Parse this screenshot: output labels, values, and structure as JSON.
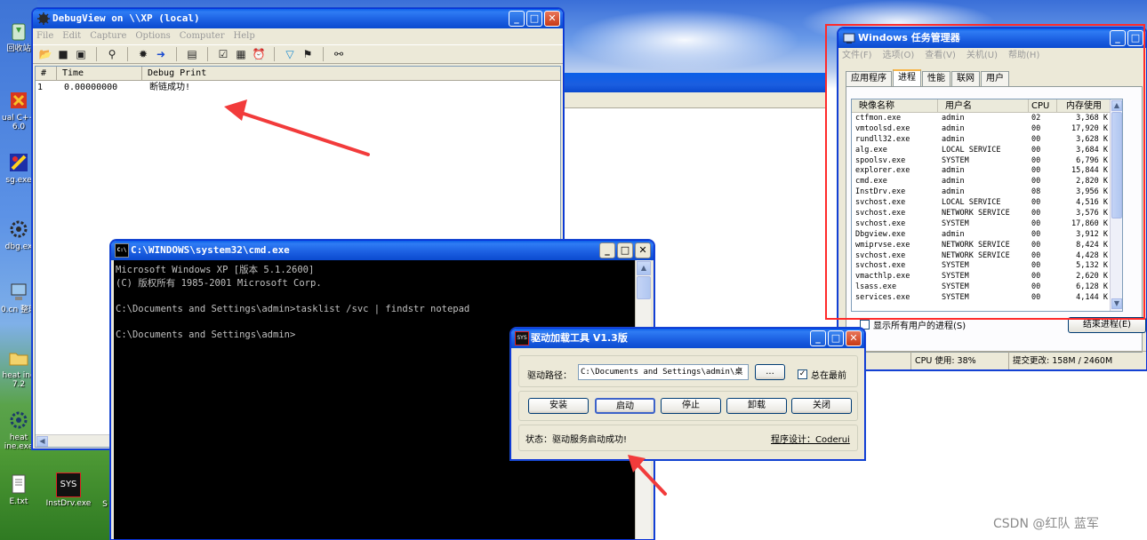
{
  "debugview": {
    "title": "DebugView on \\\\XP (local)",
    "menu": [
      "File",
      "Edit",
      "Capture",
      "Options",
      "Computer",
      "Help"
    ],
    "columns": [
      "#",
      "Time",
      "Debug Print"
    ],
    "rows": [
      {
        "num": "1",
        "time": "0.00000000",
        "msg": "断链成功!"
      }
    ]
  },
  "taskmgr": {
    "title": "Windows 任务管理器",
    "menu": [
      "文件(F)",
      "选项(O)",
      "查看(V)",
      "关机(U)",
      "帮助(H)"
    ],
    "tabs": [
      "应用程序",
      "进程",
      "性能",
      "联网",
      "用户"
    ],
    "active_tab": "进程",
    "columns": [
      "映像名称",
      "用户名",
      "CPU",
      "内存使用"
    ],
    "rows": [
      {
        "name": "ctfmon.exe",
        "user": "admin",
        "cpu": "02",
        "mem": "3,368 K"
      },
      {
        "name": "vmtoolsd.exe",
        "user": "admin",
        "cpu": "00",
        "mem": "17,920 K"
      },
      {
        "name": "rundll32.exe",
        "user": "admin",
        "cpu": "00",
        "mem": "3,628 K"
      },
      {
        "name": "alg.exe",
        "user": "LOCAL SERVICE",
        "cpu": "00",
        "mem": "3,684 K"
      },
      {
        "name": "spoolsv.exe",
        "user": "SYSTEM",
        "cpu": "00",
        "mem": "6,796 K"
      },
      {
        "name": "explorer.exe",
        "user": "admin",
        "cpu": "00",
        "mem": "15,844 K"
      },
      {
        "name": "cmd.exe",
        "user": "admin",
        "cpu": "00",
        "mem": "2,820 K"
      },
      {
        "name": "InstDrv.exe",
        "user": "admin",
        "cpu": "08",
        "mem": "3,956 K"
      },
      {
        "name": "svchost.exe",
        "user": "LOCAL SERVICE",
        "cpu": "00",
        "mem": "4,516 K"
      },
      {
        "name": "svchost.exe",
        "user": "NETWORK SERVICE",
        "cpu": "00",
        "mem": "3,576 K"
      },
      {
        "name": "svchost.exe",
        "user": "SYSTEM",
        "cpu": "00",
        "mem": "17,860 K"
      },
      {
        "name": "Dbgview.exe",
        "user": "admin",
        "cpu": "00",
        "mem": "3,912 K"
      },
      {
        "name": "wmiprvse.exe",
        "user": "NETWORK SERVICE",
        "cpu": "00",
        "mem": "8,424 K"
      },
      {
        "name": "svchost.exe",
        "user": "NETWORK SERVICE",
        "cpu": "00",
        "mem": "4,428 K"
      },
      {
        "name": "svchost.exe",
        "user": "SYSTEM",
        "cpu": "00",
        "mem": "5,132 K"
      },
      {
        "name": "vmacthlp.exe",
        "user": "SYSTEM",
        "cpu": "00",
        "mem": "2,620 K"
      },
      {
        "name": "lsass.exe",
        "user": "SYSTEM",
        "cpu": "00",
        "mem": "6,128 K"
      },
      {
        "name": "services.exe",
        "user": "SYSTEM",
        "cpu": "00",
        "mem": "4,144 K"
      }
    ],
    "show_all_label": "显示所有用户的进程(S)",
    "end_process_label": "结束进程(E)",
    "status": {
      "procs": ": 29",
      "cpu": "CPU 使用: 38%",
      "commit": "提交更改: 158M / 2460M"
    }
  },
  "cmd": {
    "title": "C:\\WINDOWS\\system32\\cmd.exe",
    "icon_label": "C:\\",
    "lines": [
      "Microsoft Windows XP [版本 5.1.2600]",
      "(C) 版权所有 1985-2001 Microsoft Corp.",
      "",
      "C:\\Documents and Settings\\admin>tasklist /svc | findstr notepad",
      "",
      "C:\\Documents and Settings\\admin>"
    ]
  },
  "driver": {
    "title": "驱动加载工具 V1.3版",
    "icon_label": "SYS",
    "path_label": "驱动路径：",
    "path_value": "C:\\Documents and Settings\\admin\\桌",
    "browse_label": "...",
    "topmost_label": "总在最前",
    "buttons": {
      "install": "安装",
      "start": "启动",
      "stop": "停止",
      "unload": "卸载",
      "close": "关闭"
    },
    "status": "状态：驱动服务启动成功!",
    "author": "程序设计：Coderui"
  },
  "desktop": {
    "icons": [
      {
        "label": "回收站"
      },
      {
        "label": "ual C++ 6.0"
      },
      {
        "label": "sg.exe"
      },
      {
        "label": "dbg.ex"
      },
      {
        "label": "0.cn 整理"
      },
      {
        "label": "heat ine 7.2"
      },
      {
        "label": "heat ine.exe"
      },
      {
        "label": "E.txt"
      },
      {
        "label": "InstDrv.exe"
      },
      {
        "label": "S"
      }
    ],
    "instdrv_icon_text": "SYS"
  },
  "watermark": "CSDN @红队 蓝军",
  "colors": {
    "annotation_red": "#ff2a2a",
    "xp_blue": "#0a4ad0",
    "cmd_bg": "#000000"
  }
}
